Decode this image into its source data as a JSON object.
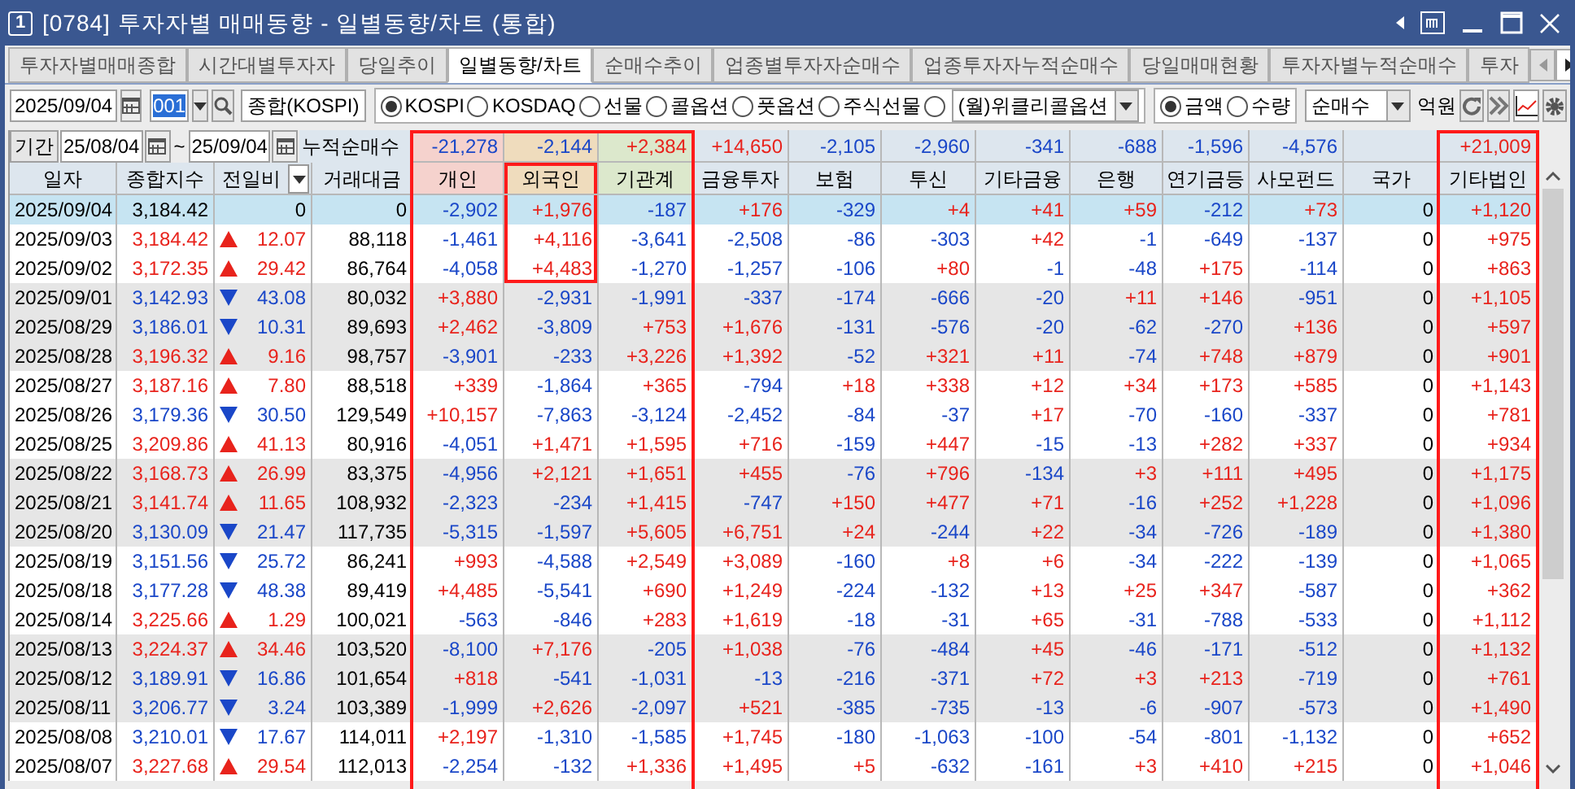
{
  "window": {
    "number": "1",
    "title": "[0784] 투자자별 매매동향 - 일별동향/차트 (통합)"
  },
  "tabs": [
    {
      "label": "투자자별매매종합",
      "selected": false
    },
    {
      "label": "시간대별투자자",
      "selected": false
    },
    {
      "label": "당일추이",
      "selected": false
    },
    {
      "label": "일별동향/차트",
      "selected": true
    },
    {
      "label": "순매수추이",
      "selected": false
    },
    {
      "label": "업종별투자자순매수",
      "selected": false
    },
    {
      "label": "업종투자자누적순매수",
      "selected": false
    },
    {
      "label": "당일매매현황",
      "selected": false
    },
    {
      "label": "투자자별누적순매수",
      "selected": false
    },
    {
      "label": "투자",
      "selected": false
    }
  ],
  "toolbar": {
    "date": "2025/09/04",
    "code": "001",
    "market_name": "종합(KOSPI)",
    "markets": [
      {
        "label": "KOSPI",
        "selected": true
      },
      {
        "label": "KOSDAQ",
        "selected": false
      },
      {
        "label": "선물",
        "selected": false
      },
      {
        "label": "콜옵션",
        "selected": false
      },
      {
        "label": "풋옵션",
        "selected": false
      },
      {
        "label": "주식선물",
        "selected": false
      }
    ],
    "weekly_option": {
      "label": "(월)위클리콜옵션",
      "selected": false
    },
    "units": [
      {
        "label": "금액",
        "selected": true
      },
      {
        "label": "수량",
        "selected": false
      }
    ],
    "trade_type": "순매수",
    "unit_label": "억원"
  },
  "period": {
    "label": "기간",
    "from": "25/08/04",
    "separator": "~",
    "to": "25/09/04",
    "total_label": "누적순매수"
  },
  "table": {
    "columns": [
      {
        "label": "일자",
        "outlined": false,
        "callout": false
      },
      {
        "label": "종합지수",
        "outlined": false,
        "callout": false
      },
      {
        "label": "전일비",
        "outlined": false,
        "callout": false
      },
      {
        "label": "거래대금",
        "outlined": false,
        "callout": false
      },
      {
        "label": "개인",
        "color": "#f5d2cd",
        "total": "-21,278",
        "outlined": true,
        "callout": false
      },
      {
        "label": "외국인",
        "color": "#efdcbd",
        "total": "-2,144",
        "outlined": true,
        "callout": true
      },
      {
        "label": "기관계",
        "color": "#dce8cc",
        "total": "+2,384",
        "outlined": true,
        "callout": false
      },
      {
        "label": "금융투자",
        "total": "+14,650",
        "outlined": false,
        "callout": false
      },
      {
        "label": "보험",
        "total": "-2,105",
        "outlined": false,
        "callout": false
      },
      {
        "label": "투신",
        "total": "-2,960",
        "outlined": false,
        "callout": false
      },
      {
        "label": "기타금융",
        "total": "-341",
        "outlined": false,
        "callout": false
      },
      {
        "label": "은행",
        "total": "-688",
        "outlined": false,
        "callout": false
      },
      {
        "label": "연기금등",
        "total": "-1,596",
        "outlined": false,
        "callout": false
      },
      {
        "label": "사모펀드",
        "total": "-4,576",
        "outlined": false,
        "callout": false
      },
      {
        "label": "국가",
        "outlined": false,
        "callout": false
      },
      {
        "label": "기타법인",
        "total": "+21,009",
        "outlined": true,
        "callout": false
      }
    ],
    "rows": [
      {
        "date": "2025/09/04",
        "index": "3,184.42",
        "change": "0",
        "amount": "0",
        "kind": "flat",
        "selected": true,
        "callout": true,
        "values": [
          "-2,902",
          "+1,976",
          "-187",
          "+176",
          "-329",
          "+4",
          "+41",
          "+59",
          "-212",
          "+73",
          "0",
          "+1,120"
        ]
      },
      {
        "date": "2025/09/03",
        "index": "3,184.42",
        "change": "12.07",
        "amount": "88,118",
        "kind": "up",
        "selected": false,
        "callout": true,
        "values": [
          "-1,461",
          "+4,116",
          "-3,641",
          "-2,508",
          "-86",
          "-303",
          "+42",
          "-1",
          "-649",
          "-137",
          "0",
          "+975"
        ]
      },
      {
        "date": "2025/09/02",
        "index": "3,172.35",
        "change": "29.42",
        "amount": "86,764",
        "kind": "up",
        "selected": false,
        "callout": true,
        "values": [
          "-4,058",
          "+4,483",
          "-1,270",
          "-1,257",
          "-106",
          "+80",
          "-1",
          "-48",
          "+175",
          "-114",
          "0",
          "+863"
        ]
      },
      {
        "date": "2025/09/01",
        "index": "3,142.93",
        "change": "43.08",
        "amount": "80,032",
        "kind": "down",
        "selected": false,
        "callout": false,
        "values": [
          "+3,880",
          "-2,931",
          "-1,991",
          "-337",
          "-174",
          "-666",
          "-20",
          "+11",
          "+146",
          "-951",
          "0",
          "+1,105"
        ]
      },
      {
        "date": "2025/08/29",
        "index": "3,186.01",
        "change": "10.31",
        "amount": "89,693",
        "kind": "down",
        "selected": false,
        "callout": false,
        "values": [
          "+2,462",
          "-3,809",
          "+753",
          "+1,676",
          "-131",
          "-576",
          "-20",
          "-62",
          "-270",
          "+136",
          "0",
          "+597"
        ]
      },
      {
        "date": "2025/08/28",
        "index": "3,196.32",
        "change": "9.16",
        "amount": "98,757",
        "kind": "up",
        "selected": false,
        "callout": false,
        "values": [
          "-3,901",
          "-233",
          "+3,226",
          "+1,392",
          "-52",
          "+321",
          "+11",
          "-74",
          "+748",
          "+879",
          "0",
          "+901"
        ]
      },
      {
        "date": "2025/08/27",
        "index": "3,187.16",
        "change": "7.80",
        "amount": "88,518",
        "kind": "up",
        "selected": false,
        "callout": false,
        "values": [
          "+339",
          "-1,864",
          "+365",
          "-794",
          "+18",
          "+338",
          "+12",
          "+34",
          "+173",
          "+585",
          "0",
          "+1,143"
        ]
      },
      {
        "date": "2025/08/26",
        "index": "3,179.36",
        "change": "30.50",
        "amount": "129,549",
        "kind": "down",
        "selected": false,
        "callout": false,
        "values": [
          "+10,157",
          "-7,863",
          "-3,124",
          "-2,452",
          "-84",
          "-37",
          "+17",
          "-70",
          "-160",
          "-337",
          "0",
          "+781"
        ]
      },
      {
        "date": "2025/08/25",
        "index": "3,209.86",
        "change": "41.13",
        "amount": "80,916",
        "kind": "up",
        "selected": false,
        "callout": false,
        "values": [
          "-4,051",
          "+1,471",
          "+1,595",
          "+716",
          "-159",
          "+447",
          "-15",
          "-13",
          "+282",
          "+337",
          "0",
          "+934"
        ]
      },
      {
        "date": "2025/08/22",
        "index": "3,168.73",
        "change": "26.99",
        "amount": "83,375",
        "kind": "up",
        "selected": false,
        "callout": false,
        "values": [
          "-4,956",
          "+2,121",
          "+1,651",
          "+455",
          "-76",
          "+796",
          "-134",
          "+3",
          "+111",
          "+495",
          "0",
          "+1,175"
        ]
      },
      {
        "date": "2025/08/21",
        "index": "3,141.74",
        "change": "11.65",
        "amount": "108,932",
        "kind": "up",
        "selected": false,
        "callout": false,
        "values": [
          "-2,323",
          "-234",
          "+1,415",
          "-747",
          "+150",
          "+477",
          "+71",
          "-16",
          "+252",
          "+1,228",
          "0",
          "+1,096"
        ]
      },
      {
        "date": "2025/08/20",
        "index": "3,130.09",
        "change": "21.47",
        "amount": "117,735",
        "kind": "down",
        "selected": false,
        "callout": false,
        "values": [
          "-5,315",
          "-1,597",
          "+5,605",
          "+6,751",
          "+24",
          "-244",
          "+22",
          "-34",
          "-726",
          "-189",
          "0",
          "+1,380"
        ]
      },
      {
        "date": "2025/08/19",
        "index": "3,151.56",
        "change": "25.72",
        "amount": "86,241",
        "kind": "down",
        "selected": false,
        "callout": false,
        "values": [
          "+993",
          "-4,588",
          "+2,549",
          "+3,089",
          "-160",
          "+8",
          "+6",
          "-34",
          "-222",
          "-139",
          "0",
          "+1,065"
        ]
      },
      {
        "date": "2025/08/18",
        "index": "3,177.28",
        "change": "48.38",
        "amount": "89,419",
        "kind": "down",
        "selected": false,
        "callout": false,
        "values": [
          "+4,485",
          "-5,541",
          "+690",
          "+1,249",
          "-224",
          "-132",
          "+13",
          "+25",
          "+347",
          "-587",
          "0",
          "+362"
        ]
      },
      {
        "date": "2025/08/14",
        "index": "3,225.66",
        "change": "1.29",
        "amount": "100,021",
        "kind": "up",
        "selected": false,
        "callout": false,
        "values": [
          "-563",
          "-846",
          "+283",
          "+1,619",
          "-18",
          "-31",
          "+65",
          "-31",
          "-788",
          "-533",
          "0",
          "+1,112"
        ]
      },
      {
        "date": "2025/08/13",
        "index": "3,224.37",
        "change": "34.46",
        "amount": "103,520",
        "kind": "up",
        "selected": false,
        "callout": false,
        "values": [
          "-8,100",
          "+7,176",
          "-205",
          "+1,038",
          "-76",
          "-484",
          "+45",
          "-46",
          "-171",
          "-512",
          "0",
          "+1,132"
        ]
      },
      {
        "date": "2025/08/12",
        "index": "3,189.91",
        "change": "16.86",
        "amount": "101,654",
        "kind": "down",
        "selected": false,
        "callout": false,
        "values": [
          "+818",
          "-541",
          "-1,031",
          "-13",
          "-216",
          "-371",
          "+72",
          "+3",
          "+213",
          "-719",
          "0",
          "+761"
        ]
      },
      {
        "date": "2025/08/11",
        "index": "3,206.77",
        "change": "3.24",
        "amount": "103,389",
        "kind": "down",
        "selected": false,
        "callout": false,
        "values": [
          "-1,999",
          "+2,626",
          "-2,097",
          "+521",
          "-385",
          "-735",
          "-13",
          "-6",
          "-907",
          "-573",
          "0",
          "+1,490"
        ]
      },
      {
        "date": "2025/08/08",
        "index": "3,210.01",
        "change": "17.67",
        "amount": "114,011",
        "kind": "down",
        "selected": false,
        "callout": false,
        "values": [
          "+2,197",
          "-1,310",
          "-1,585",
          "+1,745",
          "-180",
          "-1,063",
          "-100",
          "-54",
          "-801",
          "-1,132",
          "0",
          "+652"
        ]
      },
      {
        "date": "2025/08/07",
        "index": "3,227.68",
        "change": "29.54",
        "amount": "112,013",
        "kind": "up",
        "selected": false,
        "callout": false,
        "values": [
          "-2,254",
          "-132",
          "+1,336",
          "+1,495",
          "+5",
          "-632",
          "-161",
          "+3",
          "+410",
          "+215",
          "0",
          "+1,046"
        ]
      }
    ]
  }
}
